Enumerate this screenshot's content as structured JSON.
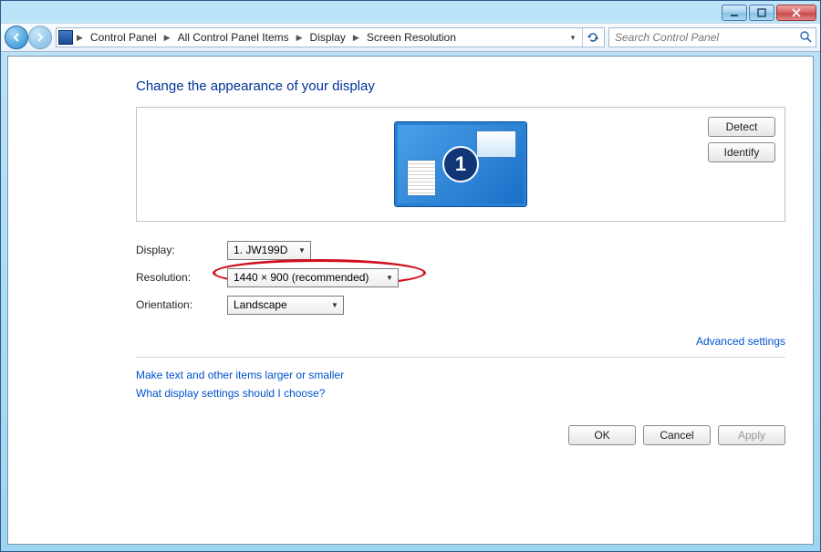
{
  "window_controls": {
    "minimize": "minimize",
    "maximize": "maximize",
    "close": "close"
  },
  "nav": {
    "back_enabled": true,
    "forward_enabled": false
  },
  "breadcrumb": {
    "items": [
      "Control Panel",
      "All Control Panel Items",
      "Display",
      "Screen Resolution"
    ]
  },
  "search": {
    "placeholder": "Search Control Panel",
    "value": ""
  },
  "page": {
    "title": "Change the appearance of your display",
    "detect_label": "Detect",
    "identify_label": "Identify",
    "monitor_number": "1"
  },
  "form": {
    "display_label": "Display:",
    "display_value": "1. JW199D",
    "resolution_label": "Resolution:",
    "resolution_value": "1440 × 900 (recommended)",
    "orientation_label": "Orientation:",
    "orientation_value": "Landscape"
  },
  "links": {
    "advanced": "Advanced settings",
    "larger_smaller": "Make text and other items larger or smaller",
    "which_settings": "What display settings should I choose?"
  },
  "buttons": {
    "ok": "OK",
    "cancel": "Cancel",
    "apply": "Apply"
  }
}
